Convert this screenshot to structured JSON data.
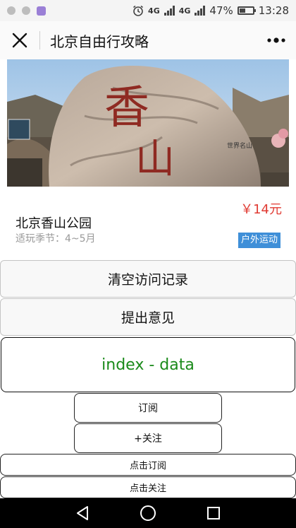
{
  "status_bar": {
    "network_primary": "4G",
    "network_secondary": "4G",
    "battery_text": "47%",
    "battery_level": 0.47,
    "time": "13:28",
    "icons": [
      "notification-icon",
      "notification-icon",
      "app-notification-icon",
      "alarm-icon",
      "signal-icon",
      "battery-icon"
    ]
  },
  "header": {
    "title": "北京自由行攻略",
    "close_icon": "close-icon",
    "more_icon": "more-dots-icon"
  },
  "card": {
    "image_text_main": "香",
    "image_text_second": "山",
    "image_text_small": "世界名山",
    "name": "北京香山公园",
    "season": "适玩季节：4~5月",
    "price": "￥14元",
    "tag": "户外运动"
  },
  "buttons": {
    "clear_history": "清空访问记录",
    "feedback": "提出意见",
    "data_display": "index - data",
    "subscribe": "订阅",
    "follow": "+关注",
    "click_subscribe": "点击订阅",
    "click_follow": "点击关注"
  },
  "colors": {
    "price": "#e03b33",
    "tag_bg": "#3f8fd8",
    "data_text": "#1a8a1a"
  },
  "nav": {
    "icons": [
      "back-icon",
      "home-icon",
      "recents-icon"
    ]
  }
}
